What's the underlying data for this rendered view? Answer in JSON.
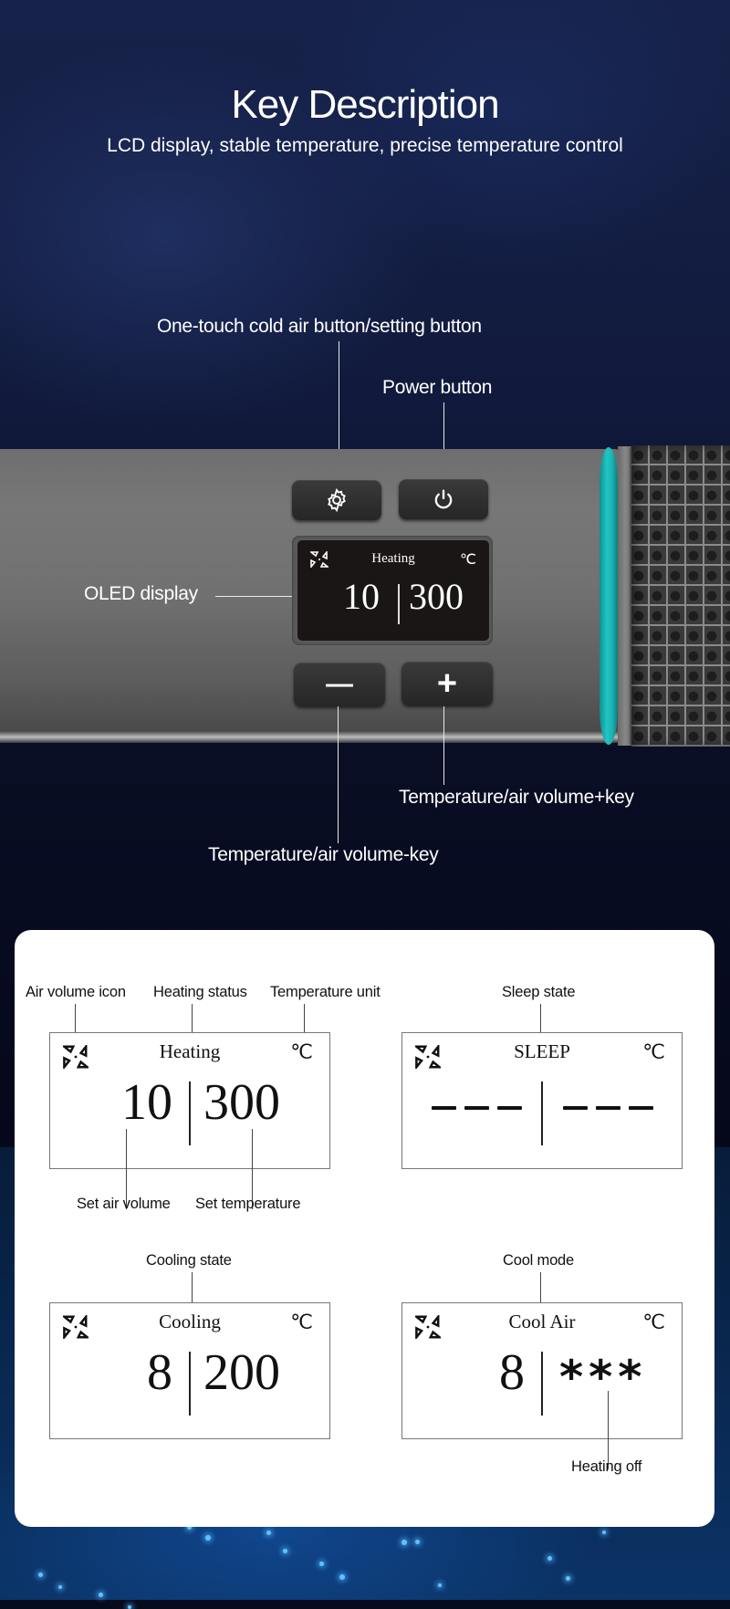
{
  "header": {
    "title": "Key Description",
    "subtitle": "LCD display, stable temperature, precise temperature control"
  },
  "product": {
    "callouts": {
      "setting_button": "One-touch cold air button/setting button",
      "power_button": "Power button",
      "oled_display": "OLED display",
      "plus_key": "Temperature/air volume+key",
      "minus_key": "Temperature/air volume-key"
    },
    "keys": {
      "setting_icon": "gear-icon",
      "power_icon": "power-icon",
      "minus_label": "—",
      "plus_label": "+"
    },
    "oled": {
      "status": "Heating",
      "unit": "℃",
      "air_volume": "10",
      "temperature": "300",
      "fan_icon": "air-volume-icon"
    },
    "colors": {
      "accent_ring": "#1ab2b2",
      "body": "#707070",
      "oled_bg": "#1b1616"
    }
  },
  "legend": {
    "panels": [
      {
        "status": "Heating",
        "unit": "℃",
        "left_value": "10",
        "right_value": "300",
        "top_labels": [
          "Air volume icon",
          "Heating status",
          "Temperature unit"
        ],
        "bottom_labels": [
          "Set air volume",
          "Set temperature"
        ]
      },
      {
        "status": "SLEEP",
        "unit": "℃",
        "left_value": "---",
        "right_value": "---",
        "top_labels": [
          "Sleep state"
        ],
        "bottom_labels": []
      },
      {
        "status": "Cooling",
        "unit": "℃",
        "left_value": "8",
        "right_value": "200",
        "top_labels": [
          "Cooling state"
        ],
        "bottom_labels": []
      },
      {
        "status": "Cool Air",
        "unit": "℃",
        "left_value": "8",
        "right_value": "***",
        "top_labels": [
          "Cool mode"
        ],
        "bottom_labels": [
          "Heating off"
        ]
      }
    ]
  }
}
